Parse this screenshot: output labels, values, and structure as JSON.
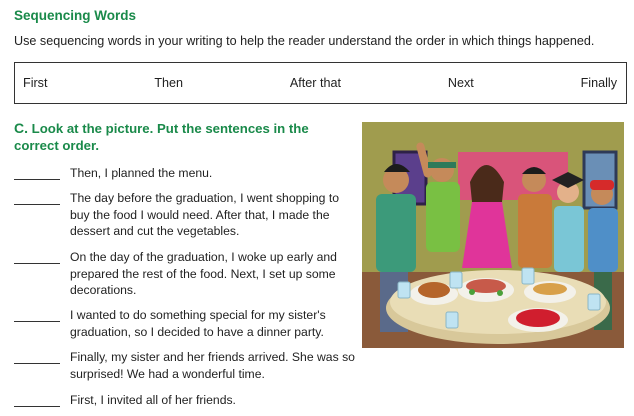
{
  "sequencing": {
    "title": "Sequencing Words",
    "instruction": "Use sequencing words in your writing to help the reader understand the order in which things happened.",
    "words": [
      "First",
      "Then",
      "After that",
      "Next",
      "Finally"
    ]
  },
  "activity": {
    "letter": "C.",
    "title": "Look at the picture. Put the sentences in the correct order.",
    "sentences": [
      "Then, I planned the menu.",
      "The day before the graduation, I went shopping to buy the food I would need. After that, I made the dessert and cut the vegetables.",
      "On the day of the graduation, I woke up early and prepared the rest of the food. Next, I set up some decorations.",
      "I wanted to do something special for my sister's graduation, so I decided to have a dinner party.",
      "Finally, my sister and her friends arrived. She was so surprised! We had a wonderful time.",
      "First, I invited all of her friends."
    ]
  },
  "colors": {
    "heading": "#1a8a4a",
    "illustration_wall": "#a09c4e"
  }
}
